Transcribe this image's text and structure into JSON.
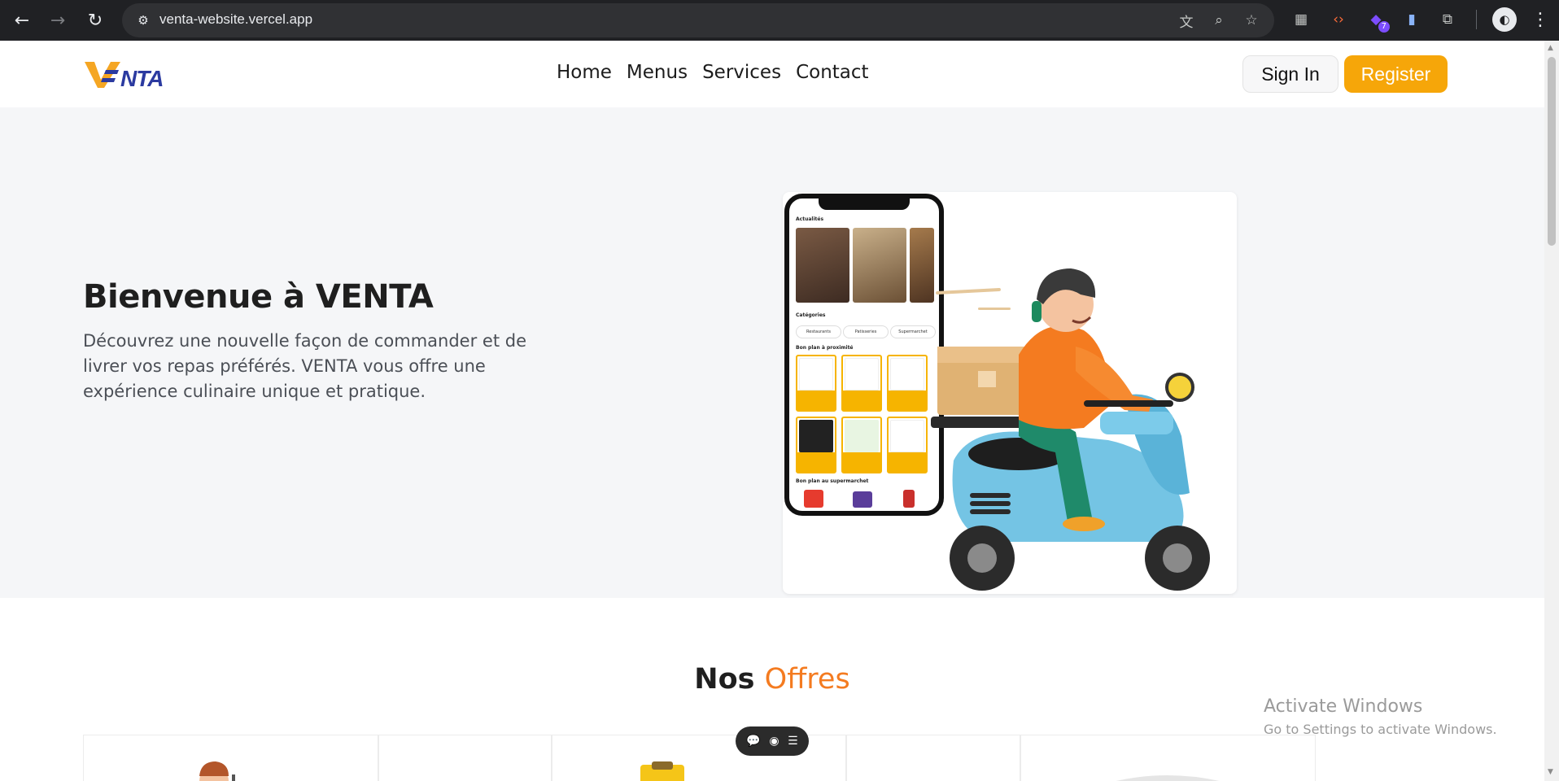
{
  "browser": {
    "url": "venta-website.vercel.app",
    "extension_badge": "7"
  },
  "header": {
    "logo_text": "VENTA",
    "nav": [
      "Home",
      "Menus",
      "Services",
      "Contact"
    ],
    "signin_label": "Sign In",
    "register_label": "Register"
  },
  "hero": {
    "title": "Bienvenue à VENTA",
    "text": "Découvrez une nouvelle façon de commander et de livrer vos repas préférés. VENTA vous offre une expérience culinaire unique et pratique."
  },
  "phone": {
    "section_news": "Actualités",
    "section_categories": "Catégories",
    "section_nearby": "Bon plan à proximité",
    "section_supermarket": "Bon plan au supermarchet",
    "chips": [
      "Restaurants",
      "Patisseries",
      "Supermarchet"
    ]
  },
  "offers": {
    "title_main": "Nos",
    "title_accent": "Offres"
  },
  "watermark": {
    "line1": "Activate Windows",
    "line2": "Go to Settings to activate Windows."
  },
  "colors": {
    "accent_orange": "#f6a609",
    "offers_accent": "#f47b20",
    "logo_blue": "#2b3aa0"
  }
}
